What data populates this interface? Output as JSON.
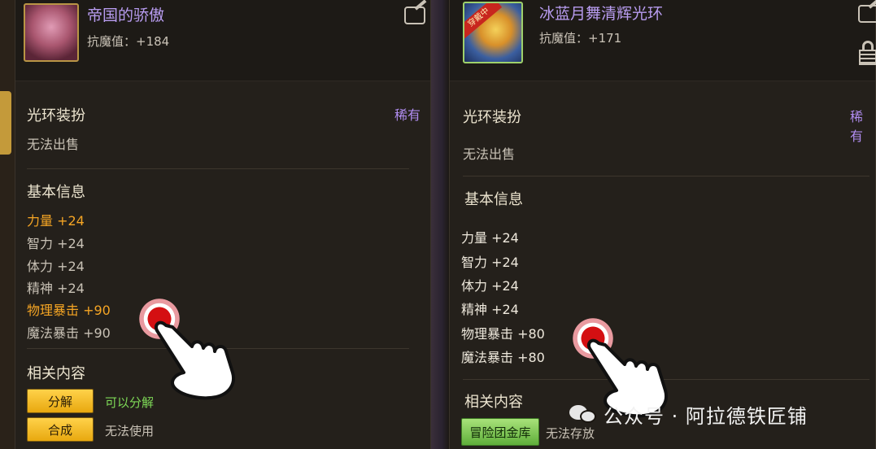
{
  "left": {
    "item_name": "帝国的骄傲",
    "anti_magic": "抗魔值：+184",
    "category": "光环装扮",
    "rarity": "稀有",
    "sell": "无法出售",
    "basic_title": "基本信息",
    "stats": [
      {
        "text": "力量 +24",
        "highlight": true
      },
      {
        "text": "智力 +24",
        "highlight": false
      },
      {
        "text": "体力 +24",
        "highlight": false
      },
      {
        "text": "精神 +24",
        "highlight": false
      },
      {
        "text": "物理暴击 +90",
        "highlight": true
      },
      {
        "text": "魔法暴击 +90",
        "highlight": false
      }
    ],
    "related_title": "相关内容",
    "actions": [
      {
        "button": "分解",
        "note": "可以分解",
        "note_color": "green"
      },
      {
        "button": "合成",
        "note": "无法使用",
        "note_color": "grey"
      }
    ]
  },
  "right": {
    "item_name": "冰蓝月舞清辉光环",
    "badge": "穿戴中",
    "anti_magic": "抗魔值：+171",
    "category": "光环装扮",
    "rarity": "稀有",
    "sell": "无法出售",
    "basic_title": "基本信息",
    "stats": [
      {
        "text": "力量 +24"
      },
      {
        "text": "智力 +24"
      },
      {
        "text": "体力 +24"
      },
      {
        "text": "精神 +24"
      },
      {
        "text": "物理暴击 +80"
      },
      {
        "text": "魔法暴击 +80"
      }
    ],
    "related_title": "相关内容",
    "action": {
      "button": "冒险团金库",
      "note": "无法存放"
    }
  },
  "watermark": "公众号 · 阿拉德铁匠铺",
  "colors": {
    "item_name": "#b89cf0",
    "highlight_stat": "#f5a524",
    "button_gold": "#ffd24a",
    "button_green": "#a8e27a",
    "note_green": "#7ed957",
    "tap_red": "#d40f12"
  }
}
